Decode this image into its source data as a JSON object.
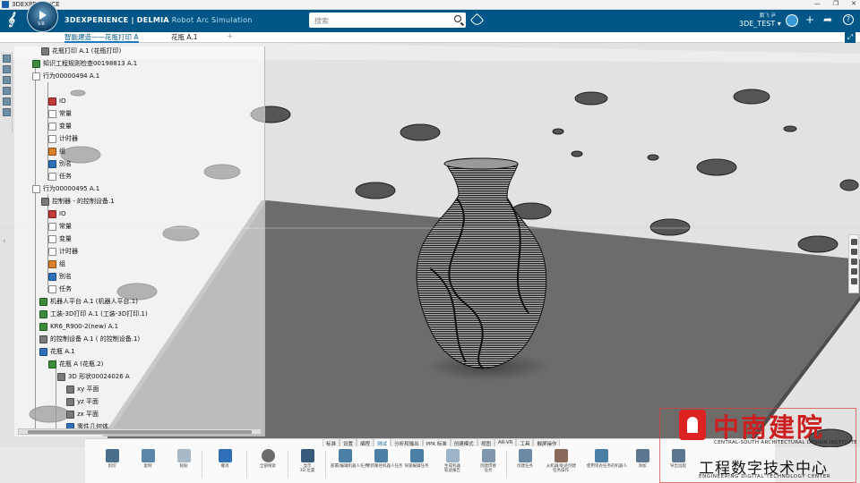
{
  "os_bar": {
    "title": "3DEXPERIENCE",
    "controls": [
      "—",
      "❐",
      "✕"
    ]
  },
  "header": {
    "brand_main": "3DEXPERIENCE | DELMIA",
    "brand_sub": "Robot Arc Simulation",
    "compass_version": "V.R",
    "search_placeholder": "搜索",
    "user_name": "鹏飞 尹",
    "tenant": "3DE_TEST ▾",
    "icons": [
      "tag-icon",
      "user-avatar",
      "add-icon",
      "share-icon",
      "help-icon"
    ]
  },
  "tabs": [
    {
      "label": "智能建造——花瓶打印 A",
      "active": true
    },
    {
      "label": "花瓶 A.1",
      "active": false
    },
    {
      "label": "+",
      "active": false
    }
  ],
  "tree": {
    "rows": [
      {
        "label": "花瓶打印 A.1 (花瓶打印)"
      },
      {
        "label": "知识工程规则检查00198813 A.1"
      },
      {
        "label": "行为00000494 A.1"
      },
      {
        "label": "IO"
      },
      {
        "label": "常量"
      },
      {
        "label": "变量"
      },
      {
        "label": "计时器"
      },
      {
        "label": "组"
      },
      {
        "label": "别名"
      },
      {
        "label": "任务"
      },
      {
        "label": "行为00000495 A.1"
      },
      {
        "label": "控制器 - 的控制设备.1"
      },
      {
        "label": "IO"
      },
      {
        "label": "常量"
      },
      {
        "label": "变量"
      },
      {
        "label": "计时器"
      },
      {
        "label": "组"
      },
      {
        "label": "别名"
      },
      {
        "label": "任务"
      },
      {
        "label": "机器人平台 A.1 (机器人平台.1)"
      },
      {
        "label": "工装-3D打印 A.1 (工装-3D打印.1)"
      },
      {
        "label": "KR6_R900-2(new) A.1"
      },
      {
        "label": "的控制设备 A.1 ( 的控制设备.1)"
      },
      {
        "label": "花瓶 A.1"
      },
      {
        "label": "花瓶 A (花瓶.2)"
      },
      {
        "label": "3D 形状00024026 A"
      },
      {
        "label": "xy 平面"
      },
      {
        "label": "yz 平面"
      },
      {
        "label": "zx 平面"
      },
      {
        "label": "零件几何体"
      }
    ]
  },
  "section_tabs": [
    "标准",
    "设置",
    "编程",
    "测试",
    "分析和输出",
    "PPR 标准",
    "创建模式",
    "视图",
    "AR-VR",
    "工具",
    "触屏操作"
  ],
  "active_section": "测试",
  "commands": [
    {
      "label": "剪切",
      "label2": ""
    },
    {
      "label": "复制",
      "label2": ""
    },
    {
      "label": "粘贴",
      "label2": ""
    },
    {
      "label": "撤消",
      "label2": ""
    },
    {
      "label": "全部搜索",
      "label2": ""
    },
    {
      "label": "显示",
      "label2": "3D 位置"
    },
    {
      "label": "部署/编辑机器人任务",
      "label2": ""
    },
    {
      "label": "更新路径机器人任务",
      "label2": ""
    },
    {
      "label": "快速编辑任务",
      "label2": ""
    },
    {
      "label": "生成机器",
      "label2": "轨迹报告"
    },
    {
      "label": "创建焊接",
      "label2": "任务"
    },
    {
      "label": "创建任务",
      "label2": ""
    },
    {
      "label": "从机器/轨迹创建",
      "label2": "任务操作"
    },
    {
      "label": "使用现有任务的机器人",
      "label2": ""
    },
    {
      "label": "添加",
      "label2": ""
    },
    {
      "label": "导出远程",
      "label2": ""
    },
    {
      "label": "",
      "label2": ""
    }
  ],
  "watermark": {
    "title": "中南建院",
    "subtitle_en": "CENTRAL-SOUTH ARCHITECTURAL DESIGN INSTITUTE",
    "line2_cn": "工程数字技术中心",
    "line2_en": "ENGINEERING DIGITAL TECHNOLOGY CENTER"
  },
  "colors": {
    "header": "#005686",
    "floor": "#e6e6e6",
    "plate": "#6e6c6a",
    "vase": "#1c1c1c",
    "watermark_red": "#cc1f1f"
  }
}
